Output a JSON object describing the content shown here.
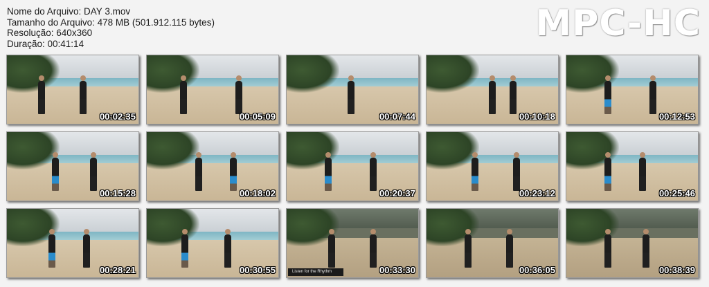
{
  "info": {
    "file_name": "Nome do Arquivo: DAY 3.mov",
    "file_size": "Tamanho do Arquivo: 478 MB (501.912.115 bytes)",
    "resolution": "Resolução: 640x360",
    "duration": "Duração: 00:41:14"
  },
  "logo": "MPC-HC",
  "thumbnails": [
    {
      "time": "00:02:35"
    },
    {
      "time": "00:05:09"
    },
    {
      "time": "00:07:44"
    },
    {
      "time": "00:10:18"
    },
    {
      "time": "00:12:53"
    },
    {
      "time": "00:15:28"
    },
    {
      "time": "00:18:02"
    },
    {
      "time": "00:20:37"
    },
    {
      "time": "00:23:12"
    },
    {
      "time": "00:25:46"
    },
    {
      "time": "00:28:21"
    },
    {
      "time": "00:30:55"
    },
    {
      "time": "00:33:30",
      "caption": "Listen for the Rhythm"
    },
    {
      "time": "00:36:05"
    },
    {
      "time": "00:38:39"
    }
  ]
}
